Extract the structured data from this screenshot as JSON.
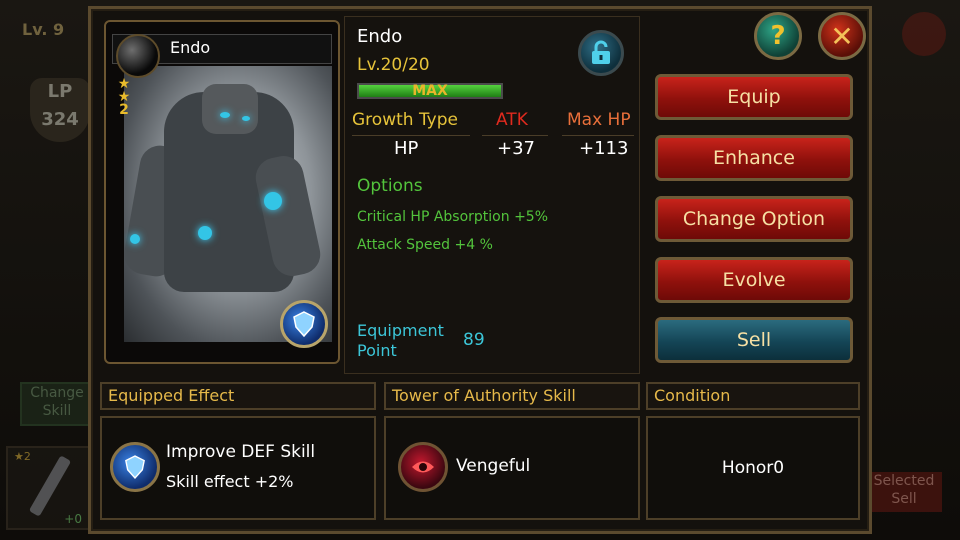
{
  "background": {
    "level_text": "Lv. 9",
    "badge_text": "LP",
    "badge_value": "324",
    "change_skill": "Change Skill",
    "item_stars": "★2",
    "item_plus": "+0",
    "selected_sell": "Selected Sell"
  },
  "card": {
    "name": "Endo",
    "stars_count": "2"
  },
  "detail": {
    "title": "Endo",
    "level": "Lv.20/20",
    "level_bar_label": "MAX",
    "level_progress": 1.0,
    "stats_headers": [
      "Growth Type",
      "ATK",
      "Max HP"
    ],
    "stats_values": [
      "HP",
      "+37",
      "+113"
    ],
    "options_title": "Options",
    "options": [
      "Critical HP Absorption +5%",
      "Attack Speed +4 %"
    ],
    "equipment_point_label": "Equipment Point",
    "equipment_point_value": "89"
  },
  "buttons": {
    "help": "?",
    "close": "✕",
    "equip": "Equip",
    "enhance": "Enhance",
    "change_option": "Change Option",
    "evolve": "Evolve",
    "sell": "Sell"
  },
  "sections": {
    "equipped_effect_title": "Equipped Effect",
    "equipped_effect_line1": "Improve DEF Skill",
    "equipped_effect_line2": "Skill effect +2%",
    "tower_title": "Tower of Authority Skill",
    "tower_skill": "Vengeful",
    "condition_title": "Condition",
    "condition_value": "Honor0"
  },
  "colors": {
    "accent_gold": "#e6c33a",
    "option_green": "#53c43c",
    "equip_cyan": "#3cc6d8",
    "atk_red": "#e02a1e",
    "maxhp_orange": "#e86f3a"
  },
  "icons": [
    "lock-open-icon",
    "help-icon",
    "close-icon",
    "shield-gem-icon",
    "vengeful-skill-icon"
  ]
}
